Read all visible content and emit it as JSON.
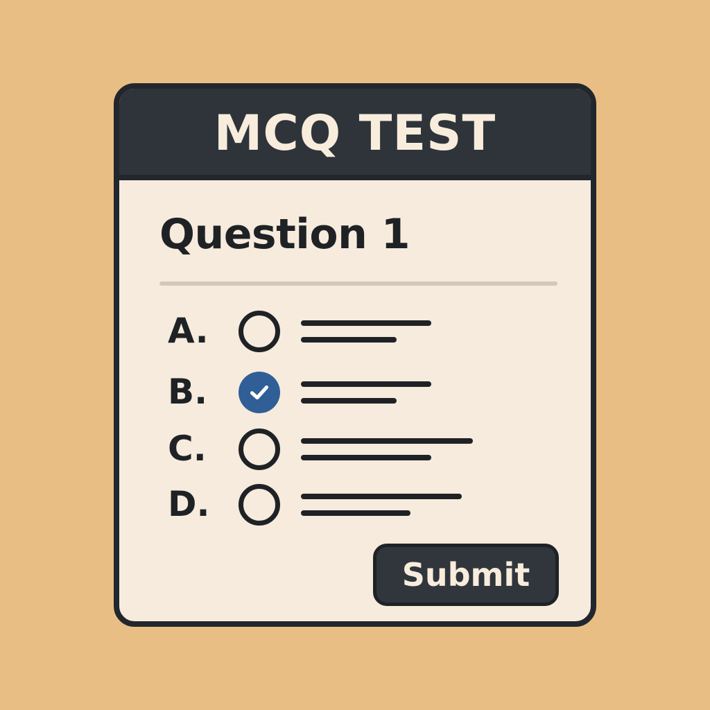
{
  "window": {
    "title": "MCQ TEST"
  },
  "question": {
    "label": "Question 1"
  },
  "options": [
    {
      "letter": "A.",
      "selected": false
    },
    {
      "letter": "B.",
      "selected": true
    },
    {
      "letter": "C.",
      "selected": false
    },
    {
      "letter": "D.",
      "selected": false
    }
  ],
  "actions": {
    "submit_label": "Submit"
  },
  "colors": {
    "background": "#e9be85",
    "panel": "#f6ebdd",
    "header": "#2e3439",
    "accent_selected": "#2f5f96",
    "text": "#1f2225"
  }
}
